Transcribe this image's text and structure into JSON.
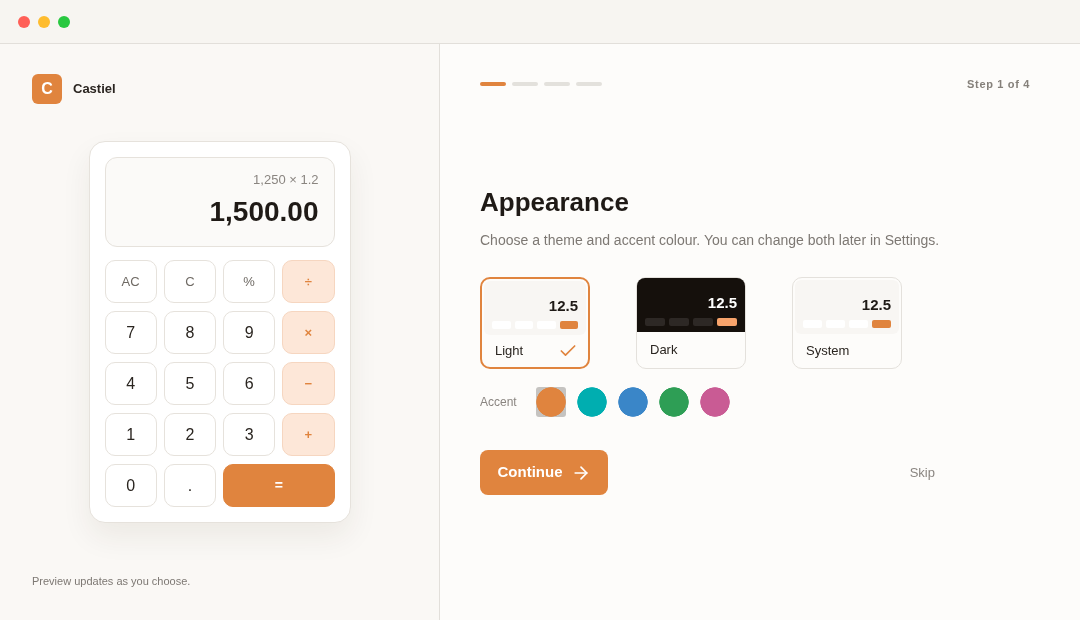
{
  "brand": {
    "initial": "C",
    "name": "Castiel"
  },
  "calculator": {
    "expression": "1,250 × 1.2",
    "result": "1,500.00",
    "keys": [
      {
        "label": "AC",
        "kind": "function"
      },
      {
        "label": "C",
        "kind": "function"
      },
      {
        "label": "%",
        "kind": "function"
      },
      {
        "label": "÷",
        "kind": "operator"
      },
      {
        "label": "7",
        "kind": "digit"
      },
      {
        "label": "8",
        "kind": "digit"
      },
      {
        "label": "9",
        "kind": "digit"
      },
      {
        "label": "×",
        "kind": "operator"
      },
      {
        "label": "4",
        "kind": "digit"
      },
      {
        "label": "5",
        "kind": "digit"
      },
      {
        "label": "6",
        "kind": "digit"
      },
      {
        "label": "−",
        "kind": "operator"
      },
      {
        "label": "1",
        "kind": "digit"
      },
      {
        "label": "2",
        "kind": "digit"
      },
      {
        "label": "3",
        "kind": "digit"
      },
      {
        "label": "+",
        "kind": "operator"
      },
      {
        "label": "0",
        "kind": "digit"
      },
      {
        "label": ".",
        "kind": "digit"
      },
      {
        "label": "=",
        "kind": "equals"
      }
    ]
  },
  "preview_note": "Preview updates as you choose.",
  "progress": [
    {
      "active": true
    },
    {
      "active": false
    },
    {
      "active": false
    },
    {
      "active": false
    }
  ],
  "step_label": "Step 1 of 4",
  "title": "Appearance",
  "subtitle": "Choose a theme and accent colour. You can change both later in Settings.",
  "themes": [
    {
      "label": "Light",
      "kind": "light",
      "preview_value": "12.5",
      "selected": true
    },
    {
      "label": "Dark",
      "kind": "dark",
      "preview_value": "12.5",
      "selected": false
    },
    {
      "label": "System",
      "kind": "system",
      "preview_value": "12.5",
      "selected": false
    }
  ],
  "accent": {
    "label": "Accent",
    "swatches": [
      {
        "color": "#e0843e",
        "selected": true
      },
      {
        "color": "#00aeb0",
        "selected": false
      },
      {
        "color": "#3a86c8",
        "selected": false
      },
      {
        "color": "#2e9e55",
        "selected": false
      },
      {
        "color": "#c95b94",
        "selected": false
      }
    ]
  },
  "actions": {
    "continue": "Continue",
    "skip": "Skip"
  }
}
